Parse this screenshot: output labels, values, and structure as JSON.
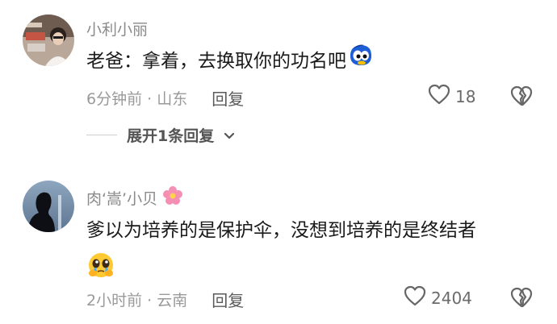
{
  "comments": [
    {
      "username": "小利小丽",
      "text": "老爸：拿着，去换取你的功名吧",
      "time_location": "6分钟前 · 山东",
      "reply_label": "回复",
      "likes": "18",
      "expand_label": "展开1条回复"
    },
    {
      "username": "肉‘嵩’小贝",
      "text_line1": "爹以为培养的是保护伞，没想到培养的是终结者",
      "time_location": "2小时前 · 云南",
      "reply_label": "回复",
      "likes": "2404"
    }
  ],
  "icons": {
    "like": "heart-outline-icon",
    "dislike": "broken-heart-icon",
    "expand": "chevron-down-icon",
    "emoji_c1": "blue-crying-emoji-icon",
    "emoji_c2_name": "pink-flower-icon",
    "emoji_c2_text": "pleading-tearful-emoji-icon"
  },
  "colors": {
    "meta": "#9a9a9a",
    "username": "#8a8a8a",
    "text": "#1a1a1a"
  }
}
